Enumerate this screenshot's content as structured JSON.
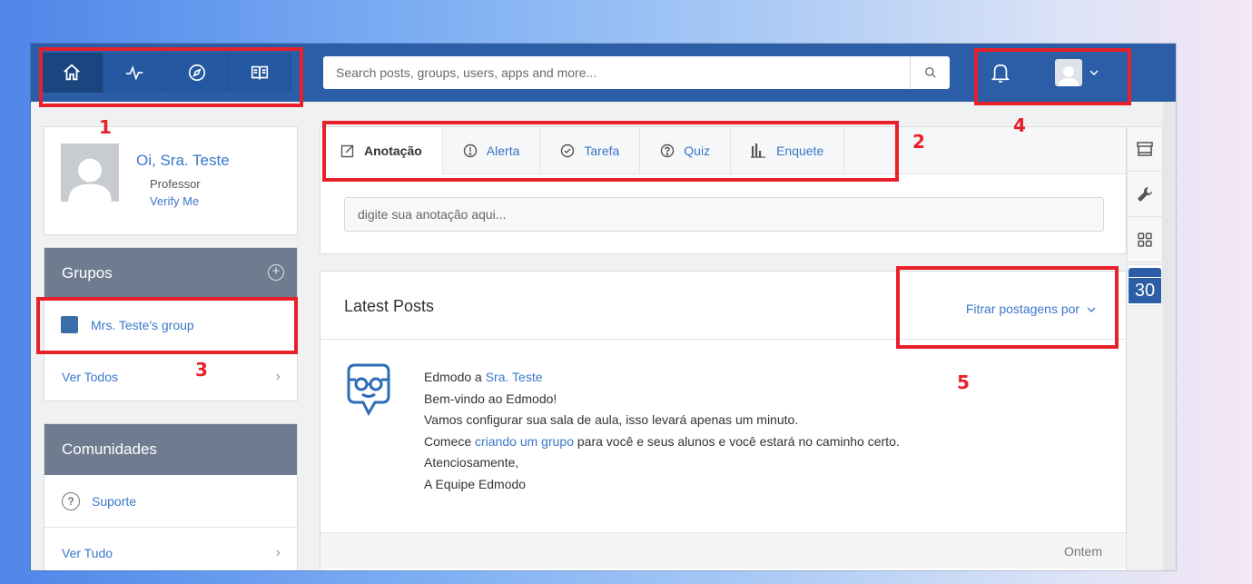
{
  "search": {
    "placeholder": "Search posts, groups, users, apps and more..."
  },
  "profile": {
    "greeting": "Oi, Sra. Teste",
    "role": "Professor",
    "verify": "Verify Me"
  },
  "groups": {
    "title": "Grupos",
    "items": [
      {
        "label": "Mrs. Teste's group",
        "color": "#3b6ea8"
      }
    ],
    "see_all": "Ver Todos"
  },
  "communities": {
    "title": "Comunidades",
    "items": [
      {
        "label": "Suporte"
      }
    ],
    "see_all": "Ver Tudo"
  },
  "composer": {
    "tabs": [
      {
        "label": "Anotação",
        "icon": "edit-icon",
        "active": true
      },
      {
        "label": "Alerta",
        "icon": "alert-icon"
      },
      {
        "label": "Tarefa",
        "icon": "check-icon"
      },
      {
        "label": "Quiz",
        "icon": "question-icon"
      },
      {
        "label": "Enquete",
        "icon": "poll-icon"
      }
    ],
    "placeholder": "digite sua anotação aqui..."
  },
  "posts": {
    "title": "Latest Posts",
    "filter": "Fitrar postagens por",
    "items": [
      {
        "from": "Edmodo a",
        "to": "Sra. Teste",
        "line1": "Bem-vindo ao Edmodo!",
        "line2": "Vamos configurar sua sala de aula, isso levará apenas um minuto.",
        "line3_pre": "Comece",
        "line3_link": "criando um grupo",
        "line3_post": "para você e seus alunos e você estará no caminho certo.",
        "line4": "Atenciosamente,",
        "line5": "A Equipe Edmodo",
        "time": "Ontem"
      }
    ]
  },
  "rail": {
    "calendar_day": "30"
  },
  "annotations": {
    "n1": "1",
    "n2": "2",
    "n3": "3",
    "n4": "4",
    "n5": "5"
  },
  "colors": {
    "topbar": "#2b5ea7",
    "link": "#3a77c8",
    "annotation": "#e8202a",
    "panel_header": "#6f7c90"
  }
}
